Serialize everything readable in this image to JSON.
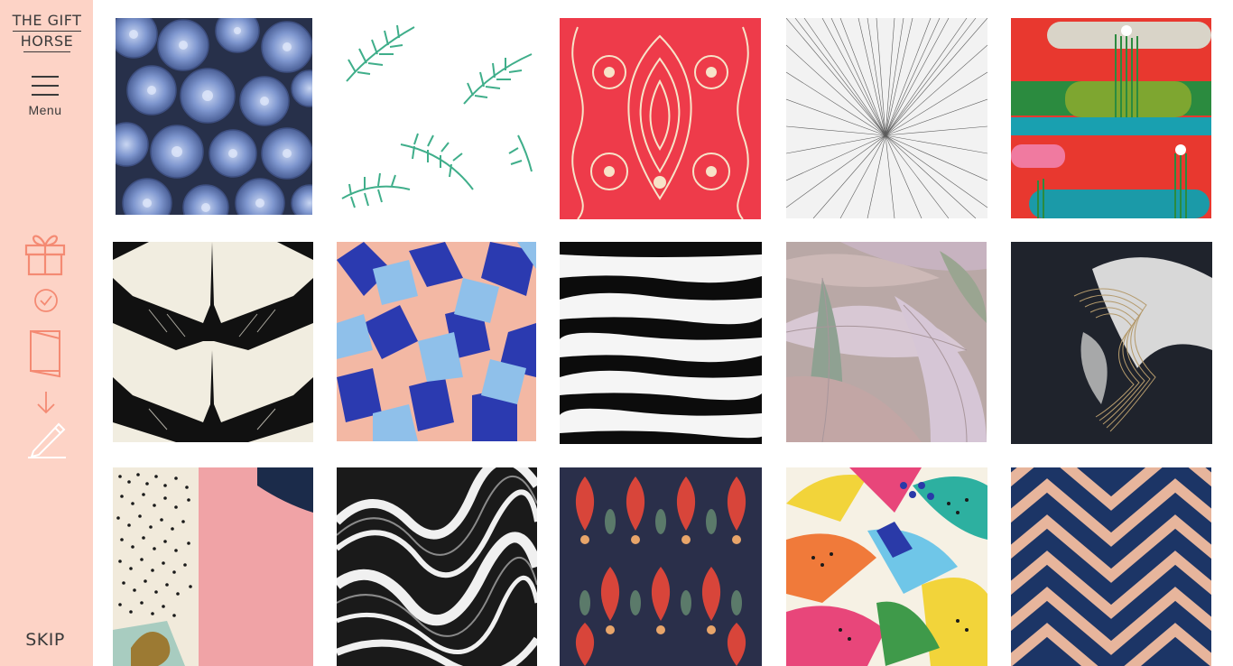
{
  "brand": {
    "line1": "THE GIFT",
    "line2": "HORSE"
  },
  "sidebar": {
    "menu_label": "Menu",
    "skip_label": "SKIP",
    "icons": [
      "gift-icon",
      "check-circle-icon",
      "card-icon",
      "arrow-down-icon",
      "pen-icon"
    ],
    "color": "#fdd3c6"
  },
  "gallery": {
    "tiles": [
      {
        "name": "tile-blue-succulents"
      },
      {
        "name": "tile-green-palm-leaves"
      },
      {
        "name": "tile-red-paisley"
      },
      {
        "name": "tile-black-line-burst"
      },
      {
        "name": "tile-colorful-abstract-stripes"
      },
      {
        "name": "tile-black-cranes"
      },
      {
        "name": "tile-blue-pink-geometric"
      },
      {
        "name": "tile-black-white-stripes"
      },
      {
        "name": "tile-eucalyptus-leaves"
      },
      {
        "name": "tile-dark-smoke-abstract"
      },
      {
        "name": "tile-pink-dotted-collage"
      },
      {
        "name": "tile-black-white-marble"
      },
      {
        "name": "tile-floral-damask"
      },
      {
        "name": "tile-rainbow-brushstrokes"
      },
      {
        "name": "tile-navy-chevron"
      }
    ]
  }
}
